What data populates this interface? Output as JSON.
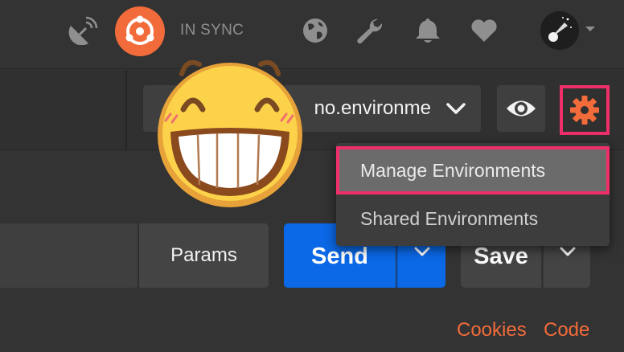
{
  "colors": {
    "accent": "#f26b3a",
    "send_blue": "#0b68e6",
    "highlight": "#ee2f69",
    "background": "#333333"
  },
  "topbar": {
    "sync_label": "IN SYNC",
    "icons": [
      "satellite-icon",
      "sync-icon",
      "globe-icon",
      "wrench-icon",
      "bell-icon",
      "heart-icon",
      "avatar",
      "chevron-down-icon"
    ]
  },
  "environment": {
    "selected_partial": "no.environme",
    "icons": [
      "chevron-down-icon",
      "eye-icon",
      "gear-icon"
    ]
  },
  "env_menu": {
    "items": [
      "Manage Environments",
      "Shared Environments"
    ]
  },
  "request": {
    "params_label": "Params",
    "send_label": "Send",
    "save_label": "Save",
    "url_value": ""
  },
  "links": {
    "cookies": "Cookies",
    "code": "Code"
  }
}
